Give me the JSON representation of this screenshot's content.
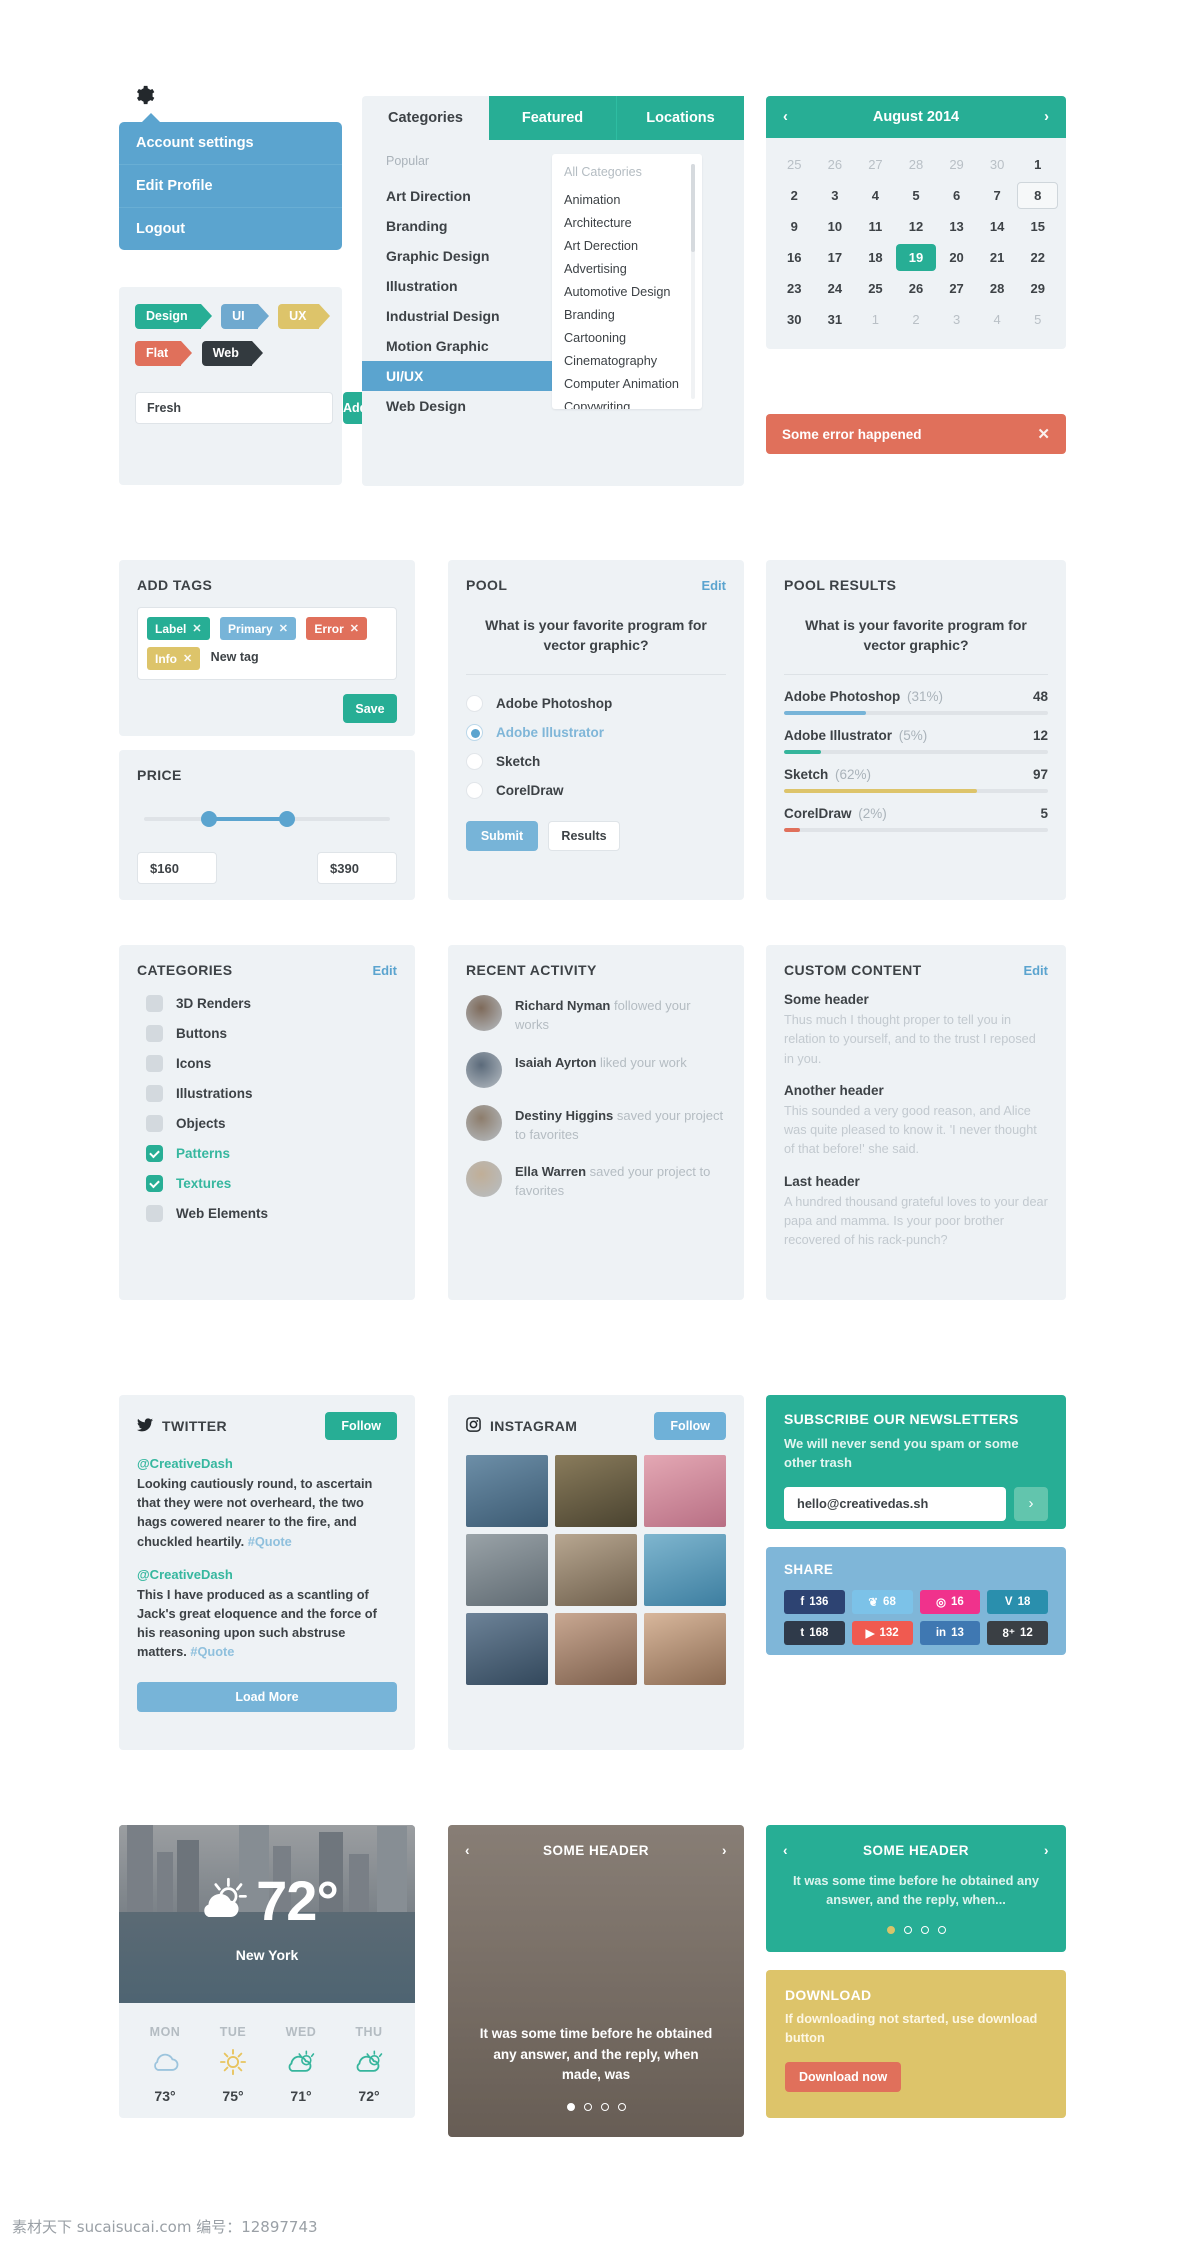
{
  "account_menu": {
    "gear_icon": "gear-icon",
    "items": [
      {
        "label": "Account settings"
      },
      {
        "label": "Edit Profile"
      },
      {
        "label": "Logout"
      }
    ]
  },
  "ribbon_tags": {
    "tags": [
      {
        "label": "Design",
        "color": "#27ae95"
      },
      {
        "label": "UI",
        "color": "#6fa9cf"
      },
      {
        "label": "UX",
        "color": "#ddc46a"
      },
      {
        "label": "Flat",
        "color": "#e0705b"
      },
      {
        "label": "Web",
        "color": "#333a3f"
      }
    ],
    "input_value": "Fresh",
    "add_label": "Add"
  },
  "categories_panel": {
    "tabs": [
      {
        "label": "Categories",
        "active": false
      },
      {
        "label": "Featured",
        "active": true
      },
      {
        "label": "Locations",
        "active": true
      }
    ],
    "left_label": "Popular",
    "left_items": [
      {
        "label": "Art Direction",
        "selected": false
      },
      {
        "label": "Branding",
        "selected": false
      },
      {
        "label": "Graphic Design",
        "selected": false
      },
      {
        "label": "Illustration",
        "selected": false
      },
      {
        "label": "Industrial Design",
        "selected": false
      },
      {
        "label": "Motion Graphic",
        "selected": false
      },
      {
        "label": "UI/UX",
        "selected": true
      },
      {
        "label": "Web Design",
        "selected": false
      }
    ],
    "right_label": "All Categories",
    "right_items": [
      "Animation",
      "Architecture",
      "Art Derection",
      "Advertising",
      "Automotive Design",
      "Branding",
      "Cartooning",
      "Cinematography",
      "Computer Animation",
      "Copywriting"
    ]
  },
  "calendar": {
    "title": "August 2014",
    "prev_icon": "chevron-left-icon",
    "next_icon": "chevron-right-icon",
    "days": [
      {
        "n": "25",
        "state": "mute"
      },
      {
        "n": "26",
        "state": "mute"
      },
      {
        "n": "27",
        "state": "mute"
      },
      {
        "n": "28",
        "state": "mute"
      },
      {
        "n": "29",
        "state": "mute"
      },
      {
        "n": "30",
        "state": "mute"
      },
      {
        "n": "1",
        "state": ""
      },
      {
        "n": "2",
        "state": ""
      },
      {
        "n": "3",
        "state": ""
      },
      {
        "n": "4",
        "state": ""
      },
      {
        "n": "5",
        "state": ""
      },
      {
        "n": "6",
        "state": ""
      },
      {
        "n": "7",
        "state": ""
      },
      {
        "n": "8",
        "state": "today"
      },
      {
        "n": "9",
        "state": ""
      },
      {
        "n": "10",
        "state": ""
      },
      {
        "n": "11",
        "state": ""
      },
      {
        "n": "12",
        "state": ""
      },
      {
        "n": "13",
        "state": ""
      },
      {
        "n": "14",
        "state": ""
      },
      {
        "n": "15",
        "state": ""
      },
      {
        "n": "16",
        "state": ""
      },
      {
        "n": "17",
        "state": ""
      },
      {
        "n": "18",
        "state": ""
      },
      {
        "n": "19",
        "state": "sel"
      },
      {
        "n": "20",
        "state": ""
      },
      {
        "n": "21",
        "state": ""
      },
      {
        "n": "22",
        "state": ""
      },
      {
        "n": "23",
        "state": ""
      },
      {
        "n": "24",
        "state": ""
      },
      {
        "n": "25",
        "state": ""
      },
      {
        "n": "26",
        "state": ""
      },
      {
        "n": "27",
        "state": ""
      },
      {
        "n": "28",
        "state": ""
      },
      {
        "n": "29",
        "state": ""
      },
      {
        "n": "30",
        "state": ""
      },
      {
        "n": "31",
        "state": ""
      },
      {
        "n": "1",
        "state": "mute"
      },
      {
        "n": "2",
        "state": "mute"
      },
      {
        "n": "3",
        "state": "mute"
      },
      {
        "n": "4",
        "state": "mute"
      },
      {
        "n": "5",
        "state": "mute"
      }
    ]
  },
  "alert": {
    "message": "Some error happened",
    "close_icon": "close-icon",
    "color": "#e0705b"
  },
  "add_tags": {
    "title": "ADD TAGS",
    "tags": [
      {
        "label": "Label",
        "color": "#27ae95"
      },
      {
        "label": "Primary",
        "color": "#77b4d8"
      },
      {
        "label": "Error",
        "color": "#e0705b"
      },
      {
        "label": "Info",
        "color": "#ddc46a"
      }
    ],
    "placeholder": "New tag",
    "save_label": "Save"
  },
  "price": {
    "title": "PRICE",
    "min_value": "$160",
    "max_value": "$390"
  },
  "pool": {
    "title": "POOL",
    "edit_label": "Edit",
    "question": "What is your favorite program for vector graphic?",
    "options": [
      {
        "label": "Adobe Photoshop",
        "selected": false
      },
      {
        "label": "Adobe Illustrator",
        "selected": true
      },
      {
        "label": "Sketch",
        "selected": false
      },
      {
        "label": "CorelDraw",
        "selected": false
      }
    ],
    "submit_label": "Submit",
    "results_label": "Results"
  },
  "pool_results": {
    "title": "POOL RESULTS",
    "question": "What is your favorite program for vector graphic?",
    "rows": [
      {
        "label": "Adobe Photoshop",
        "percent": "(31%)",
        "count": "48",
        "fill": 31,
        "color": "#77b4d8"
      },
      {
        "label": "Adobe Illustrator",
        "percent": "(5%)",
        "count": "12",
        "fill": 14,
        "color": "#35b59c"
      },
      {
        "label": "Sketch",
        "percent": "(62%)",
        "count": "97",
        "fill": 73,
        "color": "#ddc46a"
      },
      {
        "label": "CorelDraw",
        "percent": "(2%)",
        "count": "5",
        "fill": 6,
        "color": "#e0705b"
      }
    ]
  },
  "categories_list": {
    "title": "CATEGORIES",
    "edit_label": "Edit",
    "items": [
      {
        "label": "3D Renders",
        "checked": false
      },
      {
        "label": "Buttons",
        "checked": false
      },
      {
        "label": "Icons",
        "checked": false
      },
      {
        "label": "Illustrations",
        "checked": false
      },
      {
        "label": "Objects",
        "checked": false
      },
      {
        "label": "Patterns",
        "checked": true
      },
      {
        "label": "Textures",
        "checked": true
      },
      {
        "label": "Web Elements",
        "checked": false
      }
    ]
  },
  "recent_activity": {
    "title": "RECENT ACTIVITY",
    "items": [
      {
        "name": "Richard Nyman",
        "action": "followed your works"
      },
      {
        "name": "Isaiah Ayrton",
        "action": "liked your work"
      },
      {
        "name": "Destiny Higgins",
        "action": "saved your project to favorites"
      },
      {
        "name": "Ella Warren",
        "action": "saved your project to favorites"
      }
    ]
  },
  "custom_content": {
    "title": "CUSTOM CONTENT",
    "edit_label": "Edit",
    "blocks": [
      {
        "header": "Some header",
        "body": "Thus much I thought proper to tell you in relation to yourself, and to the trust I reposed in you."
      },
      {
        "header": "Another header",
        "body": "This sounded a very good reason, and Alice was quite pleased to know it. 'I never thought of that before!' she said."
      },
      {
        "header": "Last header",
        "body": "A hundred thousand grateful loves to your dear papa and mamma. Is your poor brother recovered of his rack-punch?"
      }
    ]
  },
  "twitter": {
    "title": "TWITTER",
    "icon": "twitter-bird-icon",
    "follow_label": "Follow",
    "tweets": [
      {
        "handle": "@CreativeDash",
        "text": "Looking cautiously round, to ascertain that they were not overheard, the two hags cowered nearer to the fire, and chuckled heartily. ",
        "hashtag": "#Quote"
      },
      {
        "handle": "@CreativeDash",
        "text": "This I have produced as a scantling of Jack's great eloquence and the force of his reasoning upon such abstruse matters. ",
        "hashtag": "#Quote"
      }
    ],
    "load_more_label": "Load More"
  },
  "instagram": {
    "title": "INSTAGRAM",
    "icon": "instagram-camera-icon",
    "follow_label": "Follow",
    "photos": [
      {
        "alt": "mountain-lake-photo",
        "c1": "#6d8fa8",
        "c2": "#3c5a72"
      },
      {
        "alt": "forest-path-photo",
        "c1": "#8a7c5c",
        "c2": "#4a4330"
      },
      {
        "alt": "pink-flowers-photo",
        "c1": "#e4a8b4",
        "c2": "#b86f84"
      },
      {
        "alt": "skateboarder-photo",
        "c1": "#9aa3a8",
        "c2": "#5f6a72"
      },
      {
        "alt": "man-sunglasses-photo",
        "c1": "#b8a791",
        "c2": "#6e5f4c"
      },
      {
        "alt": "yellow-kayak-photo",
        "c1": "#7fb6cf",
        "c2": "#3d7ea0"
      },
      {
        "alt": "city-skyline-photo",
        "c1": "#6d8398",
        "c2": "#33485c"
      },
      {
        "alt": "woman-portrait-photo",
        "c1": "#c9a892",
        "c2": "#7c5f4c"
      },
      {
        "alt": "woman-smiling-photo",
        "c1": "#d8b79c",
        "c2": "#8a6a52"
      }
    ]
  },
  "newsletter": {
    "title": "SUBSCRIBE OUR NEWSLETTERS",
    "subtitle": "We will never send you spam or some other trash",
    "email_value": "hello@creativedas.sh",
    "submit_icon": "chevron-right-icon"
  },
  "share": {
    "title": "SHARE",
    "buttons": [
      {
        "icon": "facebook-icon",
        "glyph": "f",
        "count": "136",
        "color": "#2d4372"
      },
      {
        "icon": "twitter-icon",
        "glyph": "❦",
        "count": "68",
        "color": "#7cc2e8"
      },
      {
        "icon": "dribbble-icon",
        "glyph": "◎",
        "count": "16",
        "color": "#f0328c"
      },
      {
        "icon": "vimeo-icon",
        "glyph": "V",
        "count": "18",
        "color": "#2a8fad"
      },
      {
        "icon": "tumblr-icon",
        "glyph": "t",
        "count": "168",
        "color": "#2f3a4a"
      },
      {
        "icon": "youtube-icon",
        "glyph": "▶",
        "count": "132",
        "color": "#f05a50"
      },
      {
        "icon": "linkedin-icon",
        "glyph": "in",
        "count": "13",
        "color": "#3f78b2"
      },
      {
        "icon": "googleplus-icon",
        "glyph": "8⁺",
        "count": "12",
        "color": "#3a3f44"
      }
    ]
  },
  "weather": {
    "city": "New York",
    "temperature": "72",
    "degree": "°",
    "current_icon": "sun-behind-cloud-icon",
    "forecast": [
      {
        "day": "MON",
        "icon": "cloud-icon",
        "temp": "73°",
        "color": "#9cc4dd"
      },
      {
        "day": "TUE",
        "icon": "sun-icon",
        "temp": "75°",
        "color": "#e8c45e"
      },
      {
        "day": "WED",
        "icon": "sun-behind-cloud-icon",
        "temp": "71°",
        "color": "#35b59c"
      },
      {
        "day": "THU",
        "icon": "sun-behind-cloud-icon",
        "temp": "72°",
        "color": "#35b59c"
      }
    ]
  },
  "slider_photo": {
    "title": "SOME HEADER",
    "prev_icon": "chevron-left-icon",
    "next_icon": "chevron-right-icon",
    "caption": "It was some time before he obtained any answer, and the reply, when made, was",
    "dots": [
      true,
      false,
      false,
      false
    ]
  },
  "slider_flat": {
    "title": "SOME HEADER",
    "prev_icon": "chevron-left-icon",
    "next_icon": "chevron-right-icon",
    "caption": "It was some time before he obtained any answer, and the reply, when...",
    "dots": [
      true,
      false,
      false,
      false
    ]
  },
  "download": {
    "title": "DOWNLOAD",
    "subtitle": "If downloading not started, use download button",
    "button_label": "Download now"
  },
  "watermark": {
    "text": "素材天下 sucaisucai.com   编号：12897743"
  }
}
